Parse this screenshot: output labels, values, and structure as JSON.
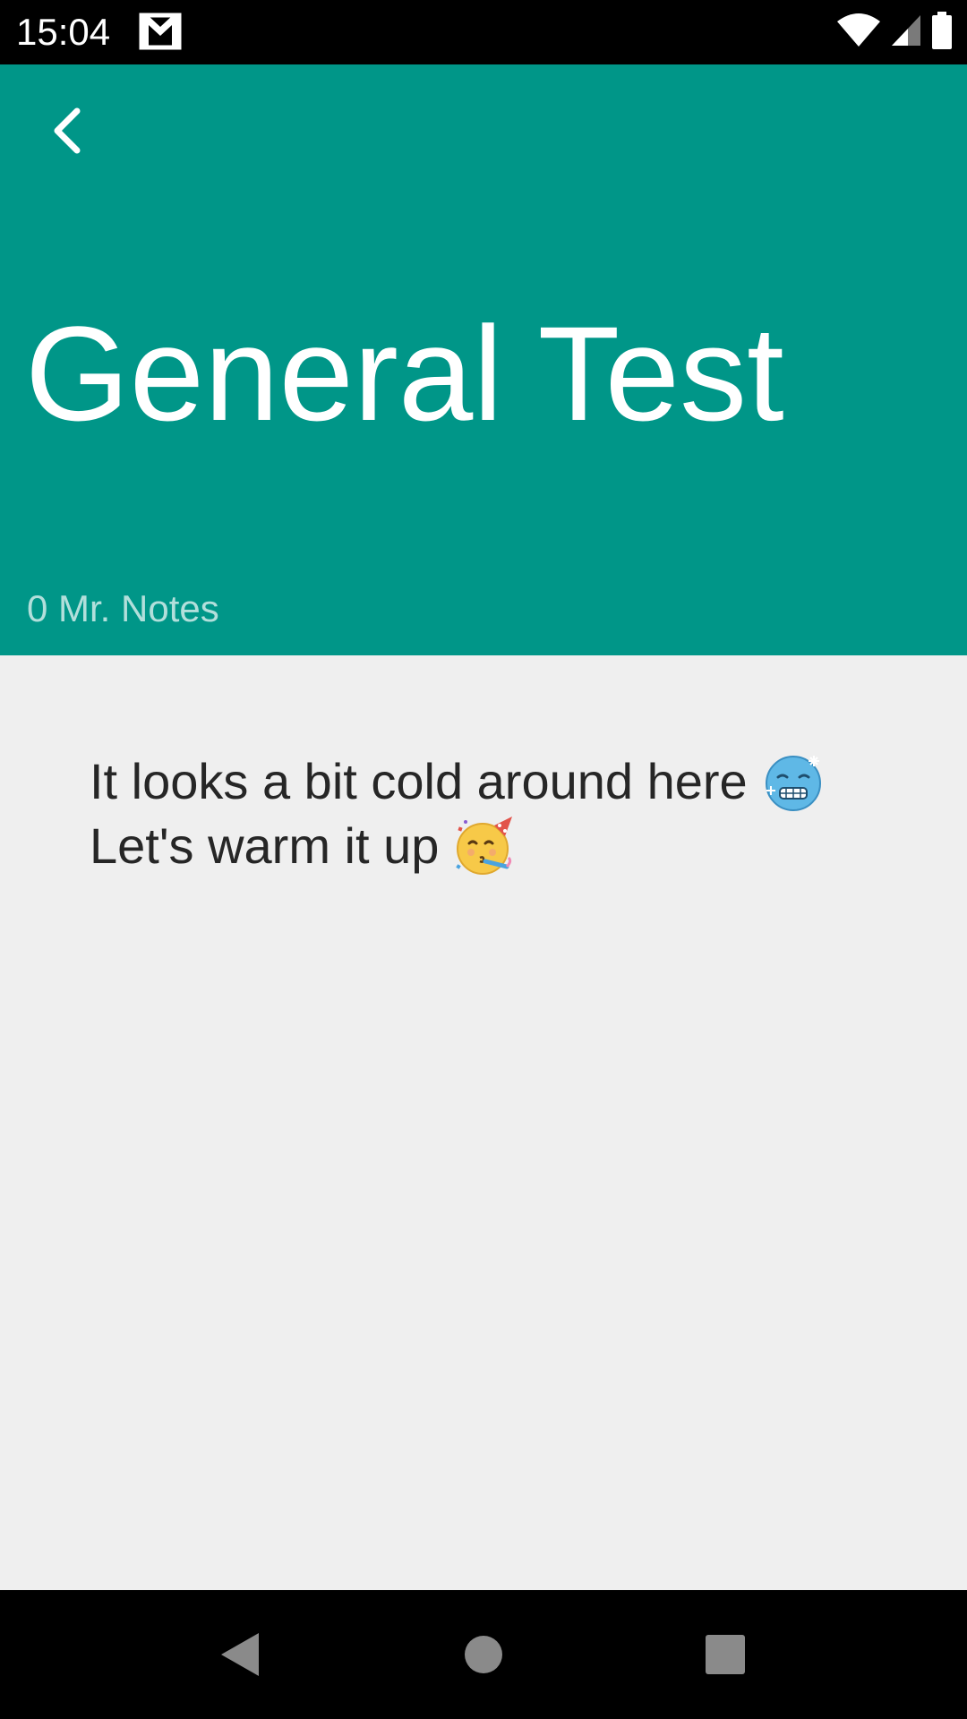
{
  "status_bar": {
    "time": "15:04",
    "notification_icons": [
      "gmail-icon"
    ],
    "system_icons": [
      "wifi-icon",
      "cellular-signal-icon",
      "battery-icon"
    ]
  },
  "header": {
    "back_icon": "back-arrow-icon",
    "title": "General Test",
    "notes_count": "0 Mr. Notes",
    "background_color": "#009688",
    "count_color": "#b2dfdb"
  },
  "content": {
    "line1": "It looks a bit cold around here",
    "line1_emoji": "cold-face-emoji",
    "line2": "Let's warm it up",
    "line2_emoji": "partying-face-emoji",
    "background_color": "#efefef"
  },
  "nav_bar": {
    "buttons": [
      "back-triangle-icon",
      "home-circle-icon",
      "recents-square-icon"
    ]
  }
}
